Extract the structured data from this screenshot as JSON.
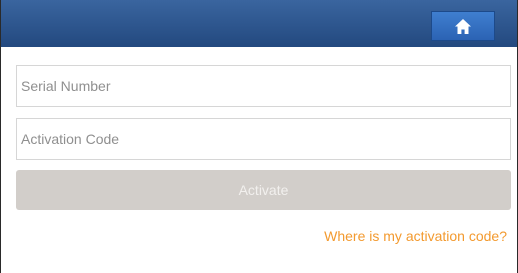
{
  "header": {
    "home_icon": "home-icon"
  },
  "form": {
    "serial_number_placeholder": "Serial Number",
    "activation_code_placeholder": "Activation Code",
    "activate_label": "Activate"
  },
  "help": {
    "activation_code_link": "Where is my activation code?"
  },
  "colors": {
    "header": "#2c5590",
    "link": "#f39a2f",
    "button_disabled": "#d2ceca"
  }
}
